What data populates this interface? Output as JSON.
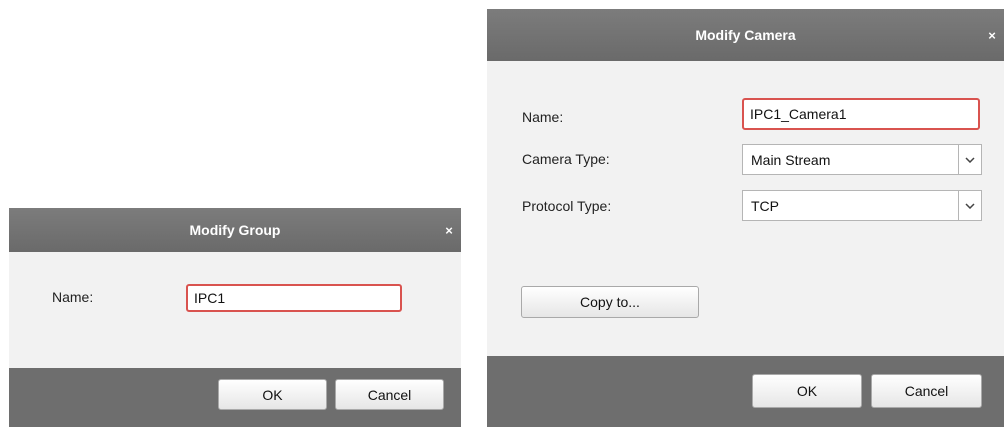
{
  "group_dialog": {
    "title": "Modify Group",
    "close_glyph": "×",
    "name_label": "Name:",
    "name_value": "IPC1",
    "ok_label": "OK",
    "cancel_label": "Cancel"
  },
  "camera_dialog": {
    "title": "Modify Camera",
    "close_glyph": "×",
    "name_label": "Name:",
    "name_value": "IPC1_Camera1",
    "camera_type_label": "Camera Type:",
    "camera_type_value": "Main Stream",
    "protocol_type_label": "Protocol Type:",
    "protocol_type_value": "TCP",
    "copy_to_label": "Copy to...",
    "ok_label": "OK",
    "cancel_label": "Cancel"
  },
  "icons": {
    "close": "close-icon",
    "dropdown": "chevron-down-icon"
  },
  "colors": {
    "titlebar": "#737373",
    "footer": "#6e6e6e",
    "dialog_body": "#f2f2f2",
    "invalid_border": "#d9534f"
  }
}
